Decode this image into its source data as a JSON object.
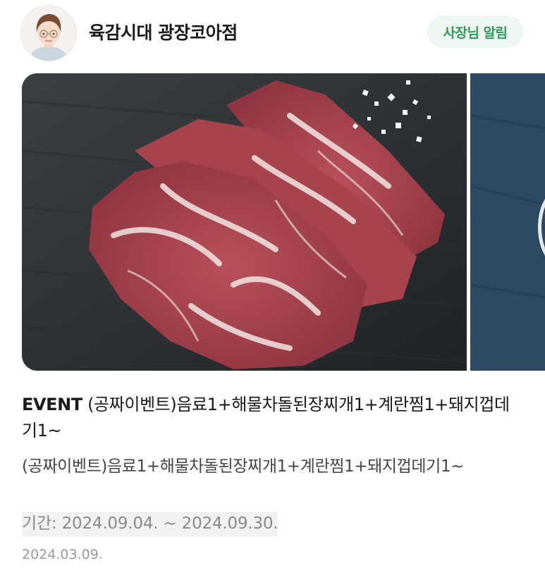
{
  "header": {
    "store_name": "육감시대 광장코아점",
    "owner_badge": "사장님 알림"
  },
  "post": {
    "tag": "EVENT",
    "title": "(공짜이벤트)음료1+해물차돌된장찌개1+계란찜1+돼지껍데기1~",
    "description": "(공짜이벤트)음료1+해물차돌된장찌개1+계란찜1+돼지껍데기1~",
    "period": "기간: 2024.09.04. ~ 2024.09.30.",
    "date": "2024.03.09."
  },
  "colors": {
    "badge_text": "#2f9a5c",
    "badge_bg": "#eef6f1"
  }
}
